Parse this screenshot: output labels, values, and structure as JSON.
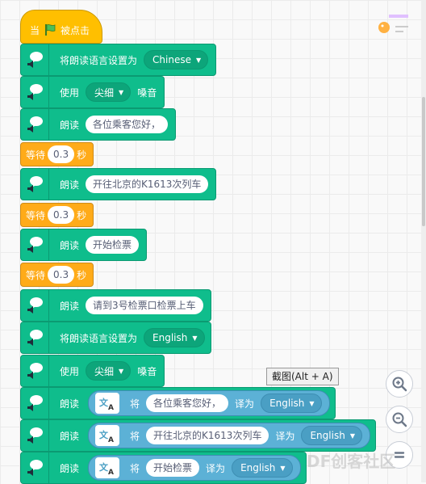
{
  "hat": {
    "when": "当",
    "clicked": "被点击"
  },
  "blocks": {
    "b1": {
      "label": "将朗读语言设置为",
      "value": "Chinese"
    },
    "b2": {
      "pre": "使用",
      "value": "尖细",
      "post": "嗓音"
    },
    "b3": {
      "label": "朗读",
      "value": "各位乘客您好，"
    },
    "w1": {
      "label": "等待",
      "value": "0.3",
      "unit": "秒"
    },
    "b4": {
      "label": "朗读",
      "value": "开往北京的K1613次列车"
    },
    "w2": {
      "label": "等待",
      "value": "0.3",
      "unit": "秒"
    },
    "b5": {
      "label": "朗读",
      "value": "开始检票"
    },
    "w3": {
      "label": "等待",
      "value": "0.3",
      "unit": "秒"
    },
    "b6": {
      "label": "朗读",
      "value": "请到3号检票口检票上车"
    },
    "b7": {
      "label": "将朗读语言设置为",
      "value": "English"
    },
    "b8": {
      "pre": "使用",
      "value": "尖细",
      "post": "嗓音"
    },
    "b9": {
      "label": "朗读",
      "translate": "将",
      "text": "各位乘客您好，",
      "to": "译为",
      "lang": "English"
    },
    "b10": {
      "label": "朗读",
      "translate": "将",
      "text": "开往北京的K1613次列车",
      "to": "译为",
      "lang": "English"
    },
    "b11": {
      "label": "朗读",
      "translate": "将",
      "text": "开始检票",
      "to": "译为",
      "lang": "English"
    }
  },
  "tooltip": "截图(Alt + A)",
  "watermark": "DF创客社区",
  "icons": {
    "tts": "speech-bubble-speaker-icon",
    "flag": "green-flag-icon",
    "translate": "translate-icon"
  },
  "colors": {
    "tts": "#0fbd8c",
    "control": "#ffab19",
    "events": "#ffbf00",
    "translate": "#5cb1d6"
  }
}
